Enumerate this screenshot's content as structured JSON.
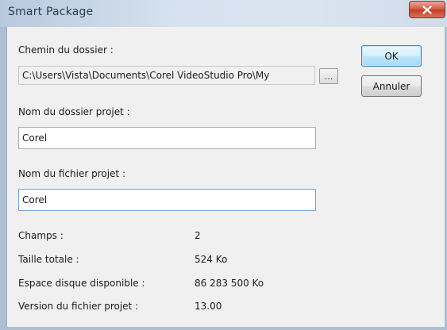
{
  "window": {
    "title": "Smart Package",
    "close_icon": "close-icon"
  },
  "folder_path": {
    "label": "Chemin du dossier :",
    "value": "C:\\Users\\Vista\\Documents\\Corel VideoStudio Pro\\My",
    "browse_label": "..."
  },
  "project_folder_name": {
    "label": "Nom du dossier projet :",
    "value": "Corel"
  },
  "project_file_name": {
    "label": "Nom du fichier projet :",
    "value": "Corel"
  },
  "buttons": {
    "ok": "OK",
    "cancel": "Annuler"
  },
  "info": {
    "fields_label": "Champs :",
    "fields_value": "2",
    "total_size_label": "Taille totale :",
    "total_size_value": "524 Ko",
    "disk_space_label": "Espace disque disponible :",
    "disk_space_value": "86 283 500 Ko",
    "version_label": "Version du fichier projet :",
    "version_value": "13.00"
  },
  "colors": {
    "title_bar": "#d6e2ef",
    "close_button": "#c33c23",
    "dialog_bg": "#f0f0f0",
    "default_button_border": "#3c7fb1"
  }
}
